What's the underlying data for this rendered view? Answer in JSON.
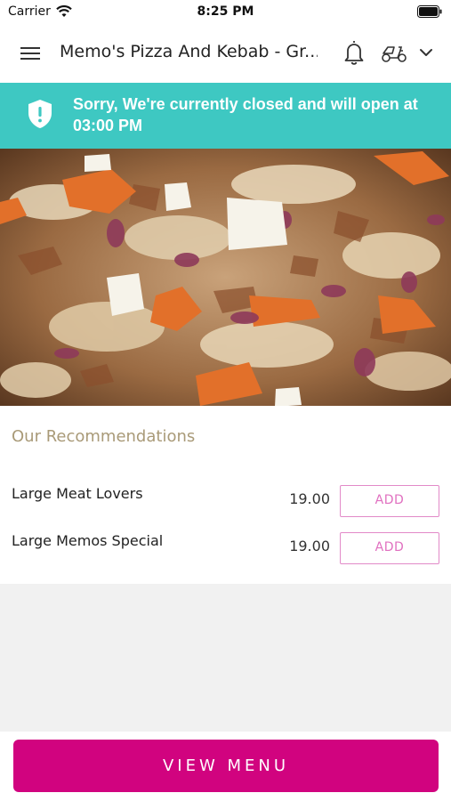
{
  "status_bar": {
    "carrier": "Carrier",
    "time": "8:25 PM"
  },
  "header": {
    "title": "Memo's Pizza And Kebab - Gr...",
    "icons": [
      "menu-icon",
      "bell-icon",
      "scooter-icon",
      "chevron-down-icon"
    ]
  },
  "banner": {
    "message": "Sorry, We're currently closed and will open at 03:00 PM",
    "color": "#3ec8c2"
  },
  "recommendations": {
    "heading": "Our Recommendations",
    "items": [
      {
        "name": "Large Meat Lovers",
        "price": "19.00",
        "button": "ADD"
      },
      {
        "name": "Large Memos Special",
        "price": "19.00",
        "button": "ADD"
      }
    ]
  },
  "footer": {
    "view_menu_label": "VIEW MENU",
    "accent_color": "#d1037f"
  }
}
